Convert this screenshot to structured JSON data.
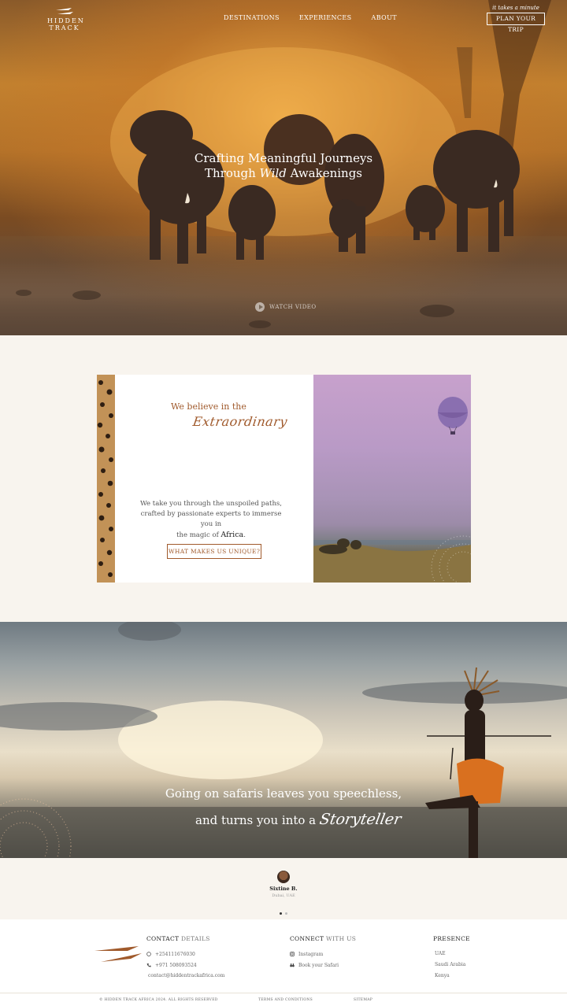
{
  "header": {
    "logo_line1": "HIDDEN",
    "logo_line2": "TRACK",
    "nav": [
      "DESTINATIONS",
      "EXPERIENCES",
      "ABOUT"
    ],
    "tagline": "it takes a minute",
    "plan_button": "PLAN YOUR TRIP"
  },
  "hero": {
    "title_line1": "Crafting Meaningful Journeys",
    "title_line2_pre": "Through ",
    "title_line2_em": "Wild",
    "title_line2_post": " Awakenings",
    "watch_label": "WATCH VIDEO"
  },
  "belief": {
    "heading": "We believe in the",
    "script": "Extraordinary",
    "desc_line1": "We take you through the unspoiled paths,",
    "desc_line2": "crafted by passionate experts to immerse you in",
    "desc_line3_pre": "the magic of ",
    "desc_line3_bold": "Africa",
    "desc_line3_post": ".",
    "button": "WHAT MAKES US UNIQUE?"
  },
  "quote": {
    "line1": "Going on safaris leaves you speechless,",
    "line2_pre": "and turns you into a ",
    "line2_script": "Storyteller"
  },
  "testimonial": {
    "name": "Sixtine B.",
    "location": "Dubai, UAE",
    "dots": 2,
    "active_dot": 0
  },
  "footer": {
    "contact": {
      "title_bold": "CONTACT",
      "title_light": " DETAILS",
      "whatsapp": "+254111676030",
      "phone": "+971 508093524",
      "email": "contact@hiddentrackafrica.com"
    },
    "connect": {
      "title_bold": "CONNECT",
      "title_light": " WITH US",
      "instagram": "Instagram",
      "book": "Book your Safari"
    },
    "presence": {
      "title": "PRESENCE",
      "items": [
        "UAE",
        "Saudi Arabia",
        "Kenya"
      ]
    },
    "copyright": "© HIDDEN TRACK AFRICA 2024. ALL RIGHTS RESERVED",
    "terms": "TERMS AND CONDITIONS",
    "sitemap": "SITEMAP"
  },
  "colors": {
    "accent": "#a05a2c",
    "footer_bg": "#ffffff",
    "section_bg": "#f8f4ee"
  }
}
